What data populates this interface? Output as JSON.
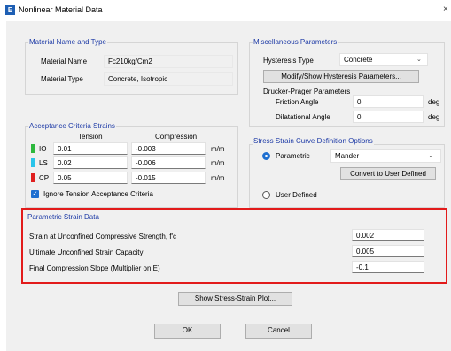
{
  "title": {
    "icon_letter": "E",
    "text": "Nonlinear Material Data",
    "close": "×"
  },
  "material": {
    "group_title": "Material Name and Type",
    "name_label": "Material Name",
    "name_value": "Fc210kg/Cm2",
    "type_label": "Material Type",
    "type_value": "Concrete, Isotropic"
  },
  "hysteresis": {
    "group_title": "Miscellaneous Parameters",
    "type_label": "Hysteresis Type",
    "type_value": "Concrete",
    "modify_button": "Modify/Show Hysteresis Parameters...",
    "dp_title": "Drucker-Prager Parameters",
    "friction_label": "Friction Angle",
    "friction_value": "0",
    "friction_unit": "deg",
    "dilatational_label": "Dilatational Angle",
    "dilatational_value": "0",
    "dilatational_unit": "deg"
  },
  "acceptance": {
    "group_title": "Acceptance Criteria Strains",
    "tension_header": "Tension",
    "compression_header": "Compression",
    "rows": [
      {
        "label": "IO",
        "tension": "0.01",
        "compression": "-0.003",
        "unit": "m/m",
        "color": "#2db83d"
      },
      {
        "label": "LS",
        "tension": "0.02",
        "compression": "-0.006",
        "unit": "m/m",
        "color": "#29c4ea"
      },
      {
        "label": "CP",
        "tension": "0.05",
        "compression": "-0.015",
        "unit": "m/m",
        "color": "#e01f1f"
      }
    ],
    "ignore_label": "Ignore Tension Acceptance Criteria",
    "ignore_checked": true
  },
  "ss_curve": {
    "group_title": "Stress Strain Curve Definition Options",
    "parametric_label": "Parametric",
    "parametric_selected": true,
    "model_value": "Mander",
    "convert_button": "Convert to User Defined",
    "user_defined_label": "User Defined"
  },
  "parametric_strain": {
    "group_title": "Parametric Strain Data",
    "rows": [
      {
        "label": "Strain at Unconfined Compressive Strength, f'c",
        "value": "0.002"
      },
      {
        "label": "Ultimate Unconfined Strain Capacity",
        "value": "0.005"
      },
      {
        "label": "Final Compression Slope (Multiplier on E)",
        "value": "-0.1"
      }
    ]
  },
  "buttons": {
    "show_plot": "Show Stress-Strain Plot...",
    "ok": "OK",
    "cancel": "Cancel"
  }
}
